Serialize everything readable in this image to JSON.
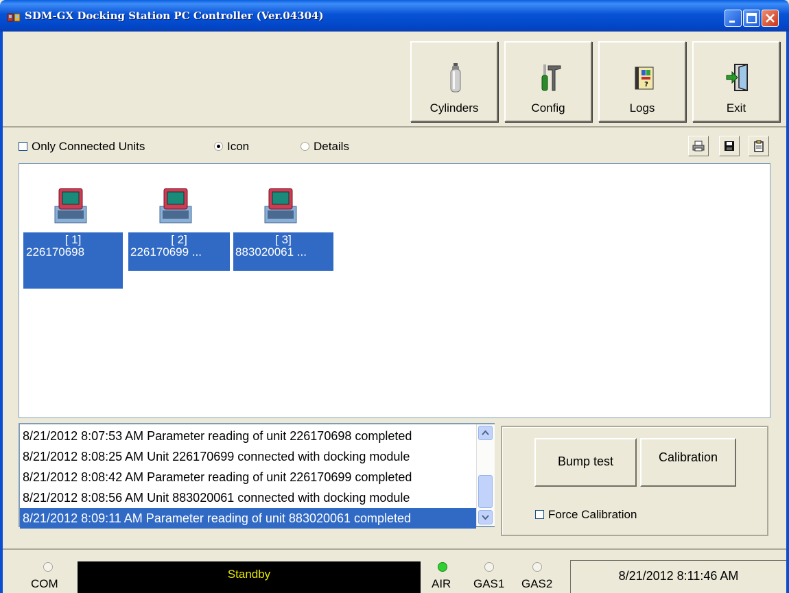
{
  "window": {
    "title": "SDM-GX Docking Station PC Controller (Ver.04304)"
  },
  "toolbar": {
    "buttons": [
      {
        "label": "Cylinders",
        "icon": "gas-cylinder-icon"
      },
      {
        "label": "Config",
        "icon": "tools-icon"
      },
      {
        "label": "Logs",
        "icon": "logbook-icon"
      },
      {
        "label": "Exit",
        "icon": "exit-door-icon"
      }
    ]
  },
  "options": {
    "only_connected_label": "Only Connected Units",
    "only_connected_checked": false,
    "view_icon_label": "Icon",
    "view_details_label": "Details",
    "view_selected": "Icon"
  },
  "units": [
    {
      "index": "[ 1]",
      "serial": "226170698"
    },
    {
      "index": "[ 2]",
      "serial": "226170699   ..."
    },
    {
      "index": "[ 3]",
      "serial": "883020061   ..."
    }
  ],
  "log": [
    "8/21/2012 8:07:53 AM Parameter reading of unit 226170698 completed",
    "8/21/2012 8:08:25 AM Unit 226170699 connected with docking module",
    "8/21/2012 8:08:42 AM Parameter reading of unit 226170699 completed",
    "8/21/2012 8:08:56 AM Unit 883020061 connected with docking module",
    "8/21/2012 8:09:11 AM Parameter reading of unit 883020061 completed"
  ],
  "actions": {
    "bump_label": "Bump test",
    "calibration_label": "Calibration",
    "force_label": "Force Calibration",
    "force_checked": false
  },
  "status": {
    "com_label": "COM",
    "message": "Standby",
    "air_label": "AIR",
    "gas1_label": "GAS1",
    "gas2_label": "GAS2",
    "air_active": true,
    "datetime": "8/21/2012 8:11:46 AM"
  }
}
